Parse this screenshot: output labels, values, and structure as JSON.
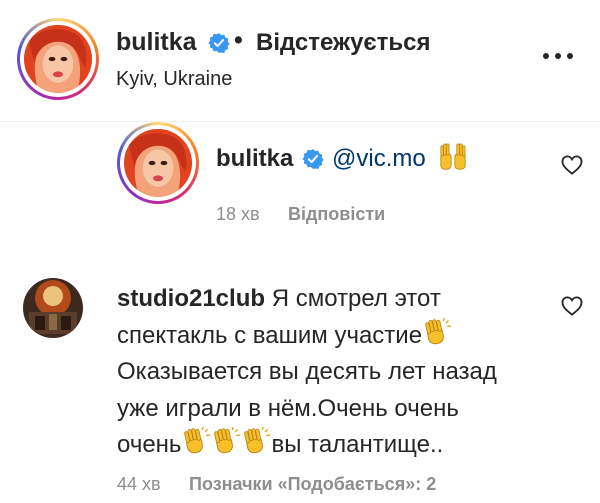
{
  "post_header": {
    "username": "bulitka",
    "separator": "•",
    "follow_status": "Відстежується",
    "location": "Kyiv, Ukraine"
  },
  "reply": {
    "username": "bulitka",
    "mention": "@vic.mo",
    "time": "18 хв",
    "reply_label": "Відповісти"
  },
  "comment": {
    "username": "studio21club",
    "line1": " Я смотрел этот",
    "line2": "спектакль с вашим участие",
    "line3": "Оказывается вы десять лет назад",
    "line4": "уже играли в нём.Очень очень",
    "line5_start": "очень",
    "line5_end": "вы талантище..",
    "time": "44 хв",
    "likes_label": "Позначки «Подобається»: 2"
  },
  "icons": {
    "verified": "verified-badge-icon",
    "more": "more-options-icon",
    "heart": "heart-outline-icon",
    "emoji_raised": "raising-hands-emoji",
    "emoji_clap": "clapping-hands-emoji"
  },
  "colors": {
    "text": "#262626",
    "secondary": "#8e8e8e",
    "mention": "#00376b",
    "verified_blue": "#3897f0",
    "emoji_yellow": "#f7c02b"
  }
}
